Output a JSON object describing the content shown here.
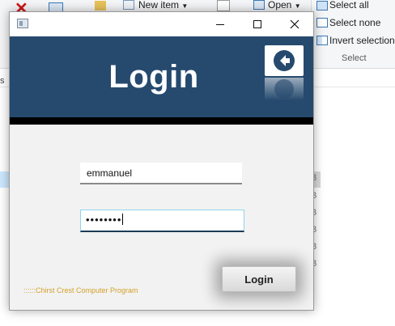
{
  "background_explorer": {
    "ribbon_items": {
      "new_item": "New item",
      "open": "Open",
      "select_all": "Select all",
      "select_none": "Select none",
      "invert_selection": "Invert selection"
    },
    "group_label": "Select",
    "row_marker": "B"
  },
  "login_window": {
    "header_title": "Login",
    "username_value": "emmanuel",
    "password_mask": "••••••••",
    "login_button": "Login",
    "footer_text": "::::::Chirst Crest Computer Program"
  },
  "colors": {
    "header_bg": "#264a6e",
    "window_bg": "#f2f2f2",
    "footer_text": "#d4a02a"
  }
}
